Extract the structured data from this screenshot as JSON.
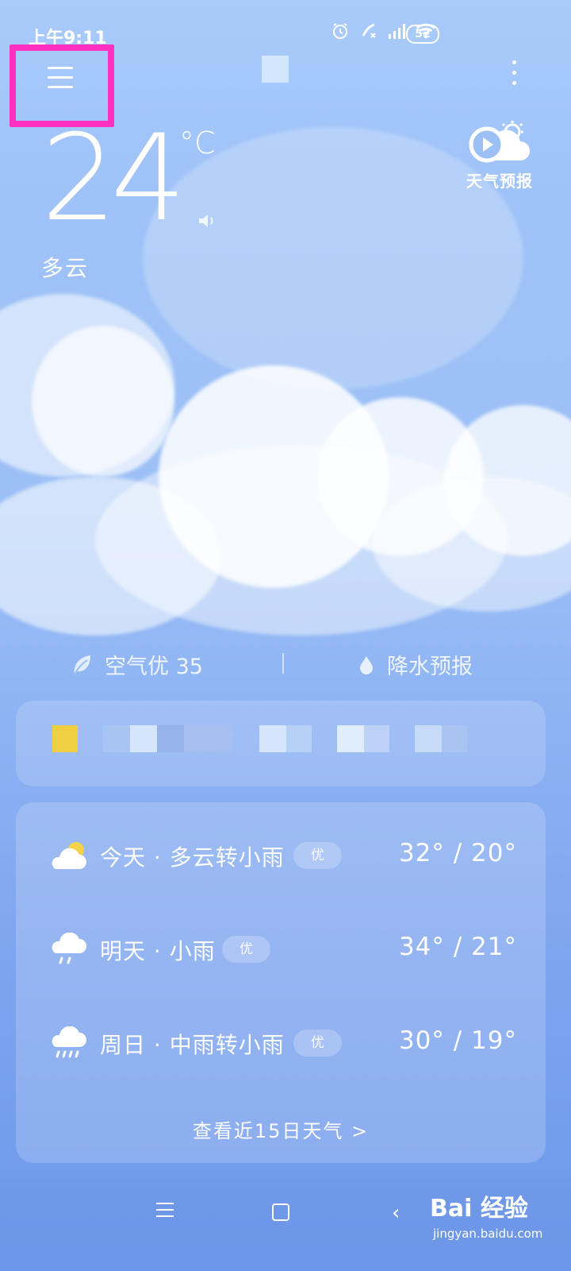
{
  "status_bar": {
    "time": "上午9:11",
    "battery": "52",
    "icons": [
      "alarm-icon",
      "call-muted-icon",
      "signal-icon",
      "wifi-icon"
    ]
  },
  "header": {
    "menu_icon": "menu-icon",
    "more_icon": "more-vertical-icon"
  },
  "current": {
    "temperature": "24",
    "unit": "°C",
    "condition": "多云",
    "forecast_video_label": "天气预报"
  },
  "info_row": {
    "air_quality": "空气优 35",
    "precipitation": "降水预报"
  },
  "daily": [
    {
      "label": "今天 · 多云转小雨",
      "aqi": "优",
      "temps": "32° / 20°",
      "icon": "partly-cloudy-icon"
    },
    {
      "label": "明天 · 小雨",
      "aqi": "优",
      "temps": "34° / 21°",
      "icon": "light-rain-icon"
    },
    {
      "label": "周日 · 中雨转小雨",
      "aqi": "优",
      "temps": "30° / 19°",
      "icon": "moderate-rain-icon"
    }
  ],
  "more_days_link": "查看近15日天气  >",
  "watermark": {
    "logo": "Bai 经验",
    "url": "jingyan.baidu.com"
  },
  "colors": {
    "highlight": "#ff2fbf",
    "sun": "#f5d24a"
  }
}
